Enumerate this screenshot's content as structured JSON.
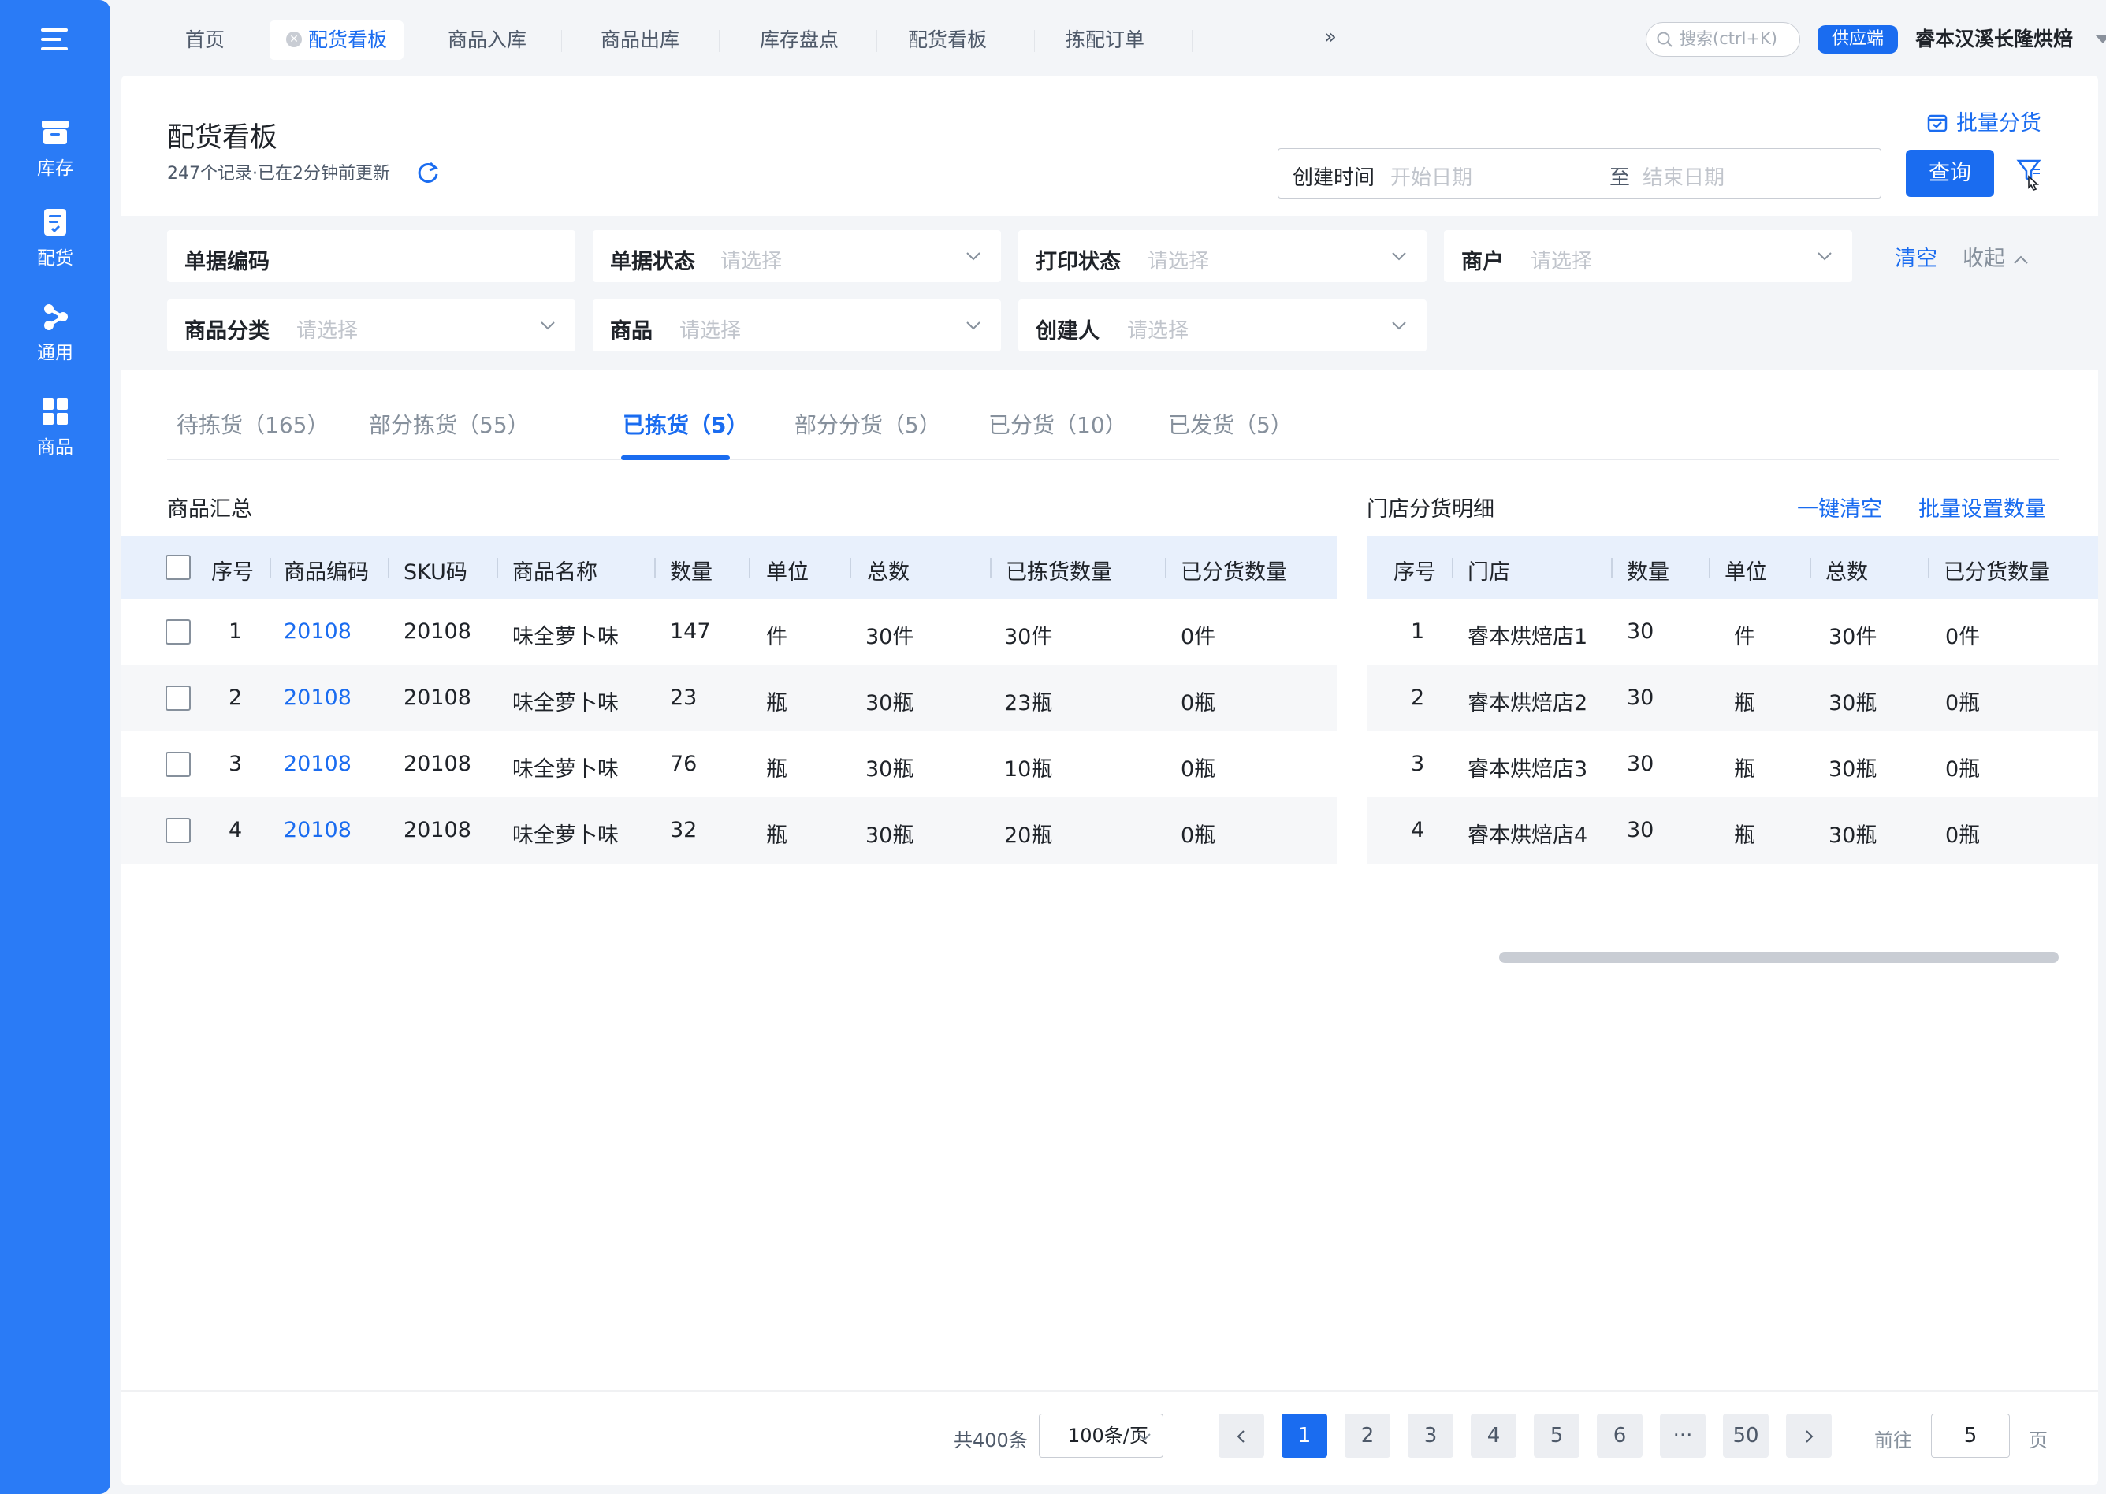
{
  "sidebar": {
    "items": [
      {
        "label": "库存",
        "icon": "archive-icon"
      },
      {
        "label": "配货",
        "icon": "document-check-icon"
      },
      {
        "label": "通用",
        "icon": "share-icon"
      },
      {
        "label": "商品",
        "icon": "grid-icon"
      }
    ]
  },
  "topnav": {
    "tabs": [
      "首页",
      "配货看板",
      "商品入库",
      "商品出库",
      "库存盘点",
      "配货看板",
      "拣配订单"
    ],
    "active_tab_index": 1,
    "search_placeholder": "搜索(ctrl+K)",
    "role_badge": "供应端",
    "company": "睿本汉溪长隆烘焙"
  },
  "header": {
    "title": "配货看板",
    "subinfo": "247个记录·已在2分钟前更新",
    "batch_link": "批量分货",
    "date_label": "创建时间",
    "date_start_placeholder": "开始日期",
    "date_to": "至",
    "date_end_placeholder": "结束日期",
    "query_button": "查询"
  },
  "filters": {
    "doc_code_label": "单据编码",
    "doc_status_label": "单据状态",
    "print_status_label": "打印状态",
    "merchant_label": "商户",
    "category_label": "商品分类",
    "product_label": "商品",
    "creator_label": "创建人",
    "select_placeholder": "请选择",
    "clear": "清空",
    "collapse": "收起"
  },
  "status_tabs": [
    "待拣货（165）",
    "部分拣货（55）",
    "已拣货（5）",
    "部分分货（5）",
    "已分货（10）",
    "已发货（5）"
  ],
  "active_status_tab_index": 2,
  "summary": {
    "title": "商品汇总",
    "columns": [
      "序号",
      "商品编码",
      "SKU码",
      "商品名称",
      "数量",
      "单位",
      "总数",
      "已拣货数量",
      "已分货数量"
    ],
    "rows": [
      [
        "1",
        "20108",
        "20108",
        "味全萝卜味",
        "147",
        "件",
        "30件",
        "30件",
        "0件"
      ],
      [
        "2",
        "20108",
        "20108",
        "味全萝卜味",
        "23",
        "瓶",
        "30瓶",
        "23瓶",
        "0瓶"
      ],
      [
        "3",
        "20108",
        "20108",
        "味全萝卜味",
        "76",
        "瓶",
        "30瓶",
        "10瓶",
        "0瓶"
      ],
      [
        "4",
        "20108",
        "20108",
        "味全萝卜味",
        "32",
        "瓶",
        "30瓶",
        "20瓶",
        "0瓶"
      ]
    ]
  },
  "detail": {
    "title": "门店分货明细",
    "clear_all": "一键清空",
    "batch_set": "批量设置数量",
    "columns": [
      "序号",
      "门店",
      "数量",
      "单位",
      "总数",
      "已分货数量"
    ],
    "rows": [
      [
        "1",
        "睿本烘焙店1",
        "30",
        "件",
        "30件",
        "0件"
      ],
      [
        "2",
        "睿本烘焙店2",
        "30",
        "瓶",
        "30瓶",
        "0瓶"
      ],
      [
        "3",
        "睿本烘焙店3",
        "30",
        "瓶",
        "30瓶",
        "0瓶"
      ],
      [
        "4",
        "睿本烘焙店4",
        "30",
        "瓶",
        "30瓶",
        "0瓶"
      ]
    ]
  },
  "pagination": {
    "total": "共400条",
    "page_size": "100条/页",
    "pages": [
      "1",
      "2",
      "3",
      "4",
      "5",
      "6",
      "···",
      "50"
    ],
    "current_page": "1",
    "goto_prefix": "前往",
    "goto_value": "5",
    "goto_suffix": "页"
  },
  "colors": {
    "primary": "#1a6cf0",
    "sidebar": "#2a7bf6",
    "notification": "#f53f3f"
  }
}
